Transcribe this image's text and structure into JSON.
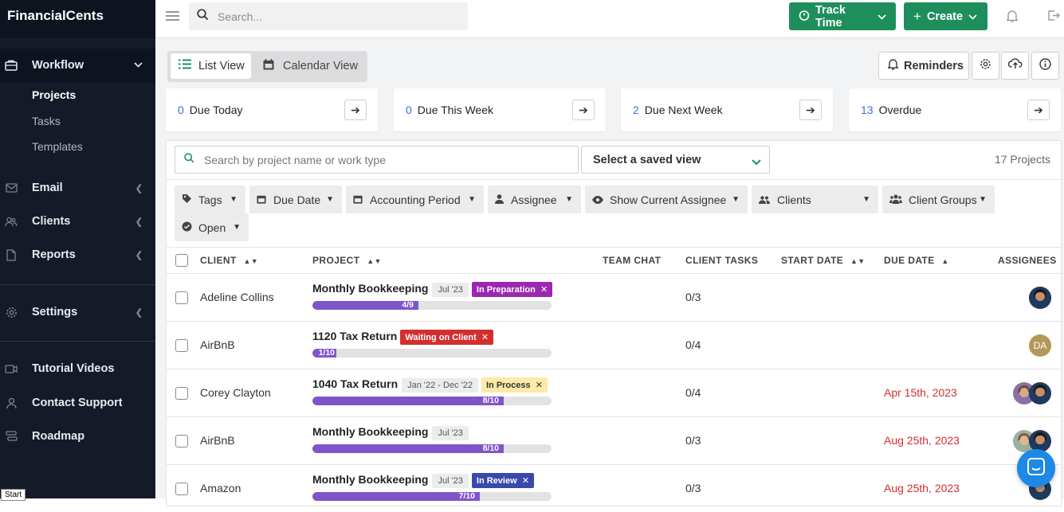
{
  "app": {
    "brand": "FinancialCents"
  },
  "sidebar": {
    "workflow": {
      "label": "Workflow",
      "items": [
        "Projects",
        "Tasks",
        "Templates"
      ]
    },
    "sections": [
      {
        "label": "Email",
        "icon": "mail-icon"
      },
      {
        "label": "Clients",
        "icon": "users-icon"
      },
      {
        "label": "Reports",
        "icon": "document-icon"
      },
      {
        "label": "Settings",
        "icon": "gear-icon"
      },
      {
        "label": "Tutorial Videos",
        "icon": "video-icon"
      },
      {
        "label": "Contact Support",
        "icon": "person-icon"
      },
      {
        "label": "Roadmap",
        "icon": "roadmap-icon"
      }
    ],
    "footer_tooltip": "Start"
  },
  "topbar": {
    "search_placeholder": "Search...",
    "track_time": "Track Time",
    "create": "Create"
  },
  "views": {
    "list": "List View",
    "calendar": "Calendar View",
    "reminders": "Reminders"
  },
  "stats": [
    {
      "count": "0",
      "label": "Due Today"
    },
    {
      "count": "0",
      "label": "Due This Week"
    },
    {
      "count": "2",
      "label": "Due Next Week"
    },
    {
      "count": "13",
      "label": "Overdue"
    }
  ],
  "panel": {
    "search_placeholder": "Search by project name or work type",
    "saved_view": "Select a saved view",
    "count": "17 Projects"
  },
  "filters": [
    "Tags",
    "Due Date",
    "Accounting Period",
    "Assignee",
    "Show Current Assignee",
    "Clients",
    "Client Groups",
    "Open"
  ],
  "columns": {
    "client": "CLIENT",
    "project": "PROJECT",
    "team_chat": "TEAM CHAT",
    "client_tasks": "CLIENT TASKS",
    "start_date": "START DATE",
    "due_date": "DUE DATE",
    "assignees": "ASSIGNEES"
  },
  "rows": [
    {
      "client": "Adeline Collins",
      "project": "Monthly Bookkeeping",
      "period": "Jul '23",
      "status": "In Preparation",
      "status_color": "#9c27b0",
      "status_text": "#ffffff",
      "progress": "4/9",
      "progress_fraction": 0.444,
      "client_tasks": "0/3",
      "due": "",
      "assignee_initials": ""
    },
    {
      "client": "AirBnB",
      "project": "1120 Tax Return",
      "period": "",
      "status": "Waiting on Client",
      "status_color": "#d32f2f",
      "status_text": "#ffffff",
      "progress": "1/10",
      "progress_fraction": 0.1,
      "client_tasks": "0/4",
      "due": "",
      "assignee_initials": "DA"
    },
    {
      "client": "Corey Clayton",
      "project": "1040 Tax Return",
      "period": "Jan '22 - Dec '22",
      "status": "In Process",
      "status_color": "#fde9a8",
      "status_text": "#333333",
      "progress": "8/10",
      "progress_fraction": 0.8,
      "client_tasks": "0/4",
      "due": "Apr 15th, 2023",
      "assignee_initials": ""
    },
    {
      "client": "AirBnB",
      "project": "Monthly Bookkeeping",
      "period": "Jul '23",
      "status": "",
      "status_color": "",
      "status_text": "",
      "progress": "8/10",
      "progress_fraction": 0.8,
      "client_tasks": "0/3",
      "due": "Aug 25th, 2023",
      "assignee_initials": ""
    },
    {
      "client": "Amazon",
      "project": "Monthly Bookkeeping",
      "period": "Jul '23",
      "status": "In Review",
      "status_color": "#3949ab",
      "status_text": "#ffffff",
      "progress": "7/10",
      "progress_fraction": 0.7,
      "client_tasks": "0/3",
      "due": "Aug 25th, 2023",
      "assignee_initials": ""
    }
  ],
  "colors": {
    "accent_green": "#1e8f5c",
    "sidebar_bg": "#141a27",
    "link_blue": "#3b6fd8",
    "overdue_red": "#d22f2f",
    "progress_purple": "#7e55c9"
  }
}
